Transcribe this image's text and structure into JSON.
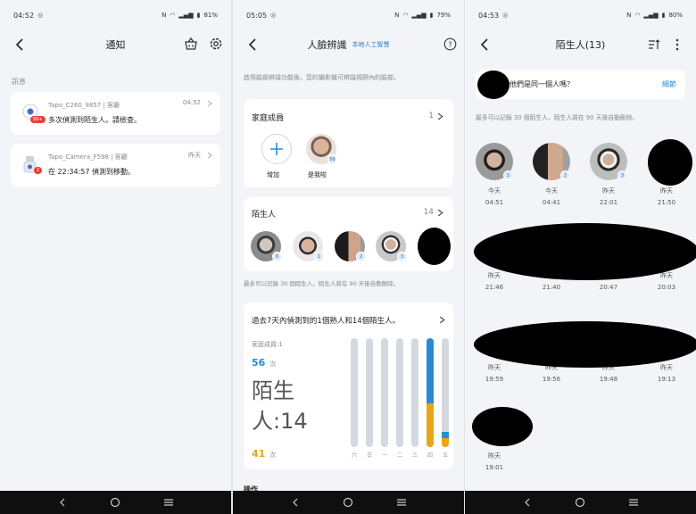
{
  "phone1": {
    "status": {
      "time": "04:52",
      "battery": "81%"
    },
    "title": "通知",
    "section": "訊息",
    "notifications": [
      {
        "device": "Tapo_C260_9857 | 客廳",
        "message": "多次偵測到陌生人。請檢查。",
        "time": "04:52",
        "badge": "99+"
      },
      {
        "device": "Tapo_Camera_F598 | 客廳",
        "message": "在 22:34:57 偵測到移動。",
        "time": "昨天",
        "badge": "2"
      }
    ]
  },
  "phone2": {
    "status": {
      "time": "05:05",
      "battery": "79%"
    },
    "title": "人臉辨識",
    "title_badge": "本地人工智慧",
    "description": "啟用臉部辨識功能後，您的攝影機可辨識視野內的臉部。",
    "family": {
      "label": "家庭成員",
      "count": "1",
      "add_label": "增加",
      "member_name": "是我啦",
      "member_count": "56"
    },
    "strangers": {
      "label": "陌生人",
      "count": "14",
      "face_counts": [
        "6",
        "1",
        "2",
        "3"
      ]
    },
    "record_note": "最多可以記錄 30 個陌生人。陌生人將在 90 天後自動刪除。",
    "stats": {
      "headline": "過去7天內偵測到的1個熟人和14個陌生人。",
      "family_label": "家庭成員:1",
      "family_times": "56",
      "times_unit": "次",
      "stranger_label_line1": "陌生",
      "stranger_label_line2": "人:14",
      "stranger_times": "41",
      "day_labels": [
        "六",
        "日",
        "一",
        "二",
        "三",
        "四",
        "五"
      ]
    },
    "next_section_peek": "操作"
  },
  "phone3": {
    "status": {
      "time": "04:53",
      "battery": "80%"
    },
    "title": "陌生人(13)",
    "prompt": "他們是同一個人嗎？",
    "details": "細節",
    "note": "最多可以記錄 30 個陌生人。陌生人將在 90 天後自動刪除。",
    "faces": [
      {
        "day": "今天",
        "time": "04:51",
        "num": "1"
      },
      {
        "day": "今天",
        "time": "04:41",
        "num": "2"
      },
      {
        "day": "昨天",
        "time": "22:01",
        "num": "3"
      },
      {
        "day": "昨天",
        "time": "21:50"
      },
      {
        "day": "昨天",
        "time": "21:46"
      },
      {
        "day": "昨天",
        "time": "21:40"
      },
      {
        "day": "昨天",
        "time": "20:47"
      },
      {
        "day": "昨天",
        "time": "20:03"
      },
      {
        "day": "昨天",
        "time": "19:59"
      },
      {
        "day": "昨天",
        "time": "19:56"
      },
      {
        "day": "昨天",
        "time": "19:48"
      },
      {
        "day": "昨天",
        "time": "19:13"
      },
      {
        "day": "昨天",
        "time": "19:01"
      }
    ]
  },
  "chart_data": {
    "type": "bar",
    "categories": [
      "六",
      "日",
      "一",
      "二",
      "三",
      "四",
      "五"
    ],
    "series": [
      {
        "name": "家庭成員",
        "values": [
          0,
          0,
          0,
          0,
          0,
          0.6,
          0.06
        ],
        "color": "#2a8ad8"
      },
      {
        "name": "陌生人",
        "values": [
          0,
          0,
          0,
          0,
          0,
          0.4,
          0.08
        ],
        "color": "#e8a517"
      }
    ],
    "ylim": [
      0,
      1
    ]
  }
}
